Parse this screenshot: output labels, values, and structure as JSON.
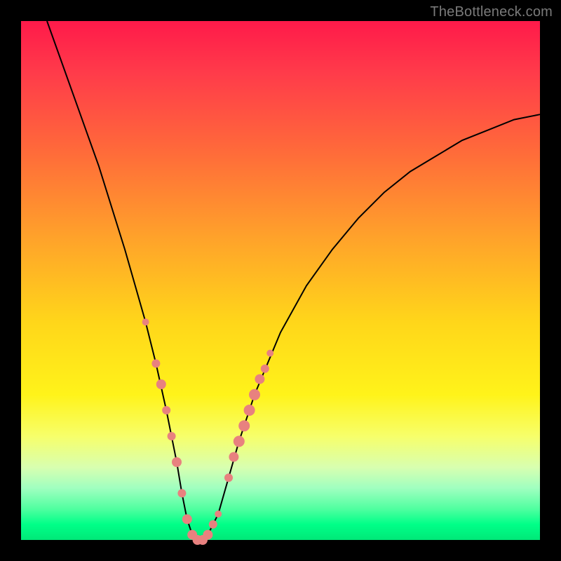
{
  "watermark": "TheBottleneck.com",
  "chart_data": {
    "type": "line",
    "title": "",
    "xlabel": "",
    "ylabel": "",
    "xlim": [
      0,
      100
    ],
    "ylim": [
      0,
      100
    ],
    "grid": false,
    "legend": false,
    "background_gradient": {
      "top_color": "#ff1a4a",
      "bottom_color": "#00e878",
      "meaning": "red=high bottleneck, green=low bottleneck"
    },
    "series": [
      {
        "name": "bottleneck-curve",
        "color": "#000000",
        "x": [
          5,
          10,
          15,
          20,
          22,
          24,
          26,
          28,
          30,
          31,
          32,
          33,
          34,
          35,
          36,
          38,
          40,
          42,
          45,
          50,
          55,
          60,
          65,
          70,
          75,
          80,
          85,
          90,
          95,
          100
        ],
        "y": [
          100,
          86,
          72,
          56,
          49,
          42,
          34,
          25,
          15,
          9,
          4,
          1,
          0,
          0,
          1,
          5,
          12,
          19,
          28,
          40,
          49,
          56,
          62,
          67,
          71,
          74,
          77,
          79,
          81,
          82
        ]
      }
    ],
    "markers": {
      "name": "highlighted-points",
      "color": "#e8817f",
      "radius_range": [
        4,
        9
      ],
      "points": [
        {
          "x": 24,
          "y": 42,
          "r": 5
        },
        {
          "x": 26,
          "y": 34,
          "r": 6
        },
        {
          "x": 27,
          "y": 30,
          "r": 7
        },
        {
          "x": 28,
          "y": 25,
          "r": 6
        },
        {
          "x": 29,
          "y": 20,
          "r": 6
        },
        {
          "x": 30,
          "y": 15,
          "r": 7
        },
        {
          "x": 31,
          "y": 9,
          "r": 6
        },
        {
          "x": 32,
          "y": 4,
          "r": 7
        },
        {
          "x": 33,
          "y": 1,
          "r": 7
        },
        {
          "x": 34,
          "y": 0,
          "r": 7
        },
        {
          "x": 35,
          "y": 0,
          "r": 7
        },
        {
          "x": 36,
          "y": 1,
          "r": 7
        },
        {
          "x": 37,
          "y": 3,
          "r": 6
        },
        {
          "x": 38,
          "y": 5,
          "r": 5
        },
        {
          "x": 40,
          "y": 12,
          "r": 6
        },
        {
          "x": 41,
          "y": 16,
          "r": 7
        },
        {
          "x": 42,
          "y": 19,
          "r": 8
        },
        {
          "x": 43,
          "y": 22,
          "r": 8
        },
        {
          "x": 44,
          "y": 25,
          "r": 8
        },
        {
          "x": 45,
          "y": 28,
          "r": 8
        },
        {
          "x": 46,
          "y": 31,
          "r": 7
        },
        {
          "x": 47,
          "y": 33,
          "r": 6
        },
        {
          "x": 48,
          "y": 36,
          "r": 5
        }
      ]
    }
  }
}
